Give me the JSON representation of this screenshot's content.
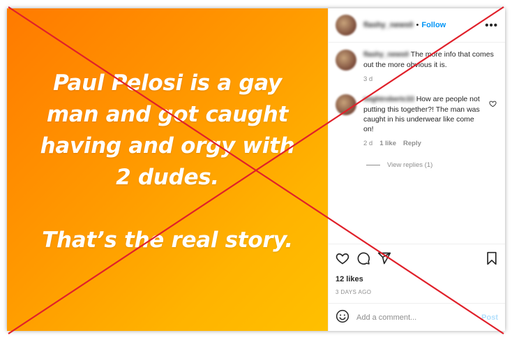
{
  "post": {
    "image_lines": [
      "Paul Pelosi is a gay",
      "man and got caught",
      "having and orgy with",
      "2 dudes.",
      "That’s the real story."
    ]
  },
  "header": {
    "username": "flashy_news0",
    "separator": "•",
    "follow_label": "Follow",
    "more_label": "•••"
  },
  "comments": [
    {
      "username": "flashy_news0",
      "text": "The more info that comes out the more obvious it is.",
      "time": "3 d"
    },
    {
      "username": "mightrobertc33",
      "text": "How are people not putting this together?! The man was caught in his underwear like come on!",
      "time": "2 d",
      "likes": "1 like",
      "reply_label": "Reply",
      "view_replies": "View replies (1)"
    }
  ],
  "actions": {
    "likes": "12 likes",
    "time_ago": "3 DAYS AGO"
  },
  "add_comment": {
    "placeholder": "Add a comment...",
    "post_label": "Post"
  },
  "overlay": {
    "cross_color": "#e0202a"
  },
  "icons": [
    "heart-icon",
    "comment-icon",
    "share-icon",
    "bookmark-icon",
    "emoji-icon",
    "more-icon"
  ]
}
